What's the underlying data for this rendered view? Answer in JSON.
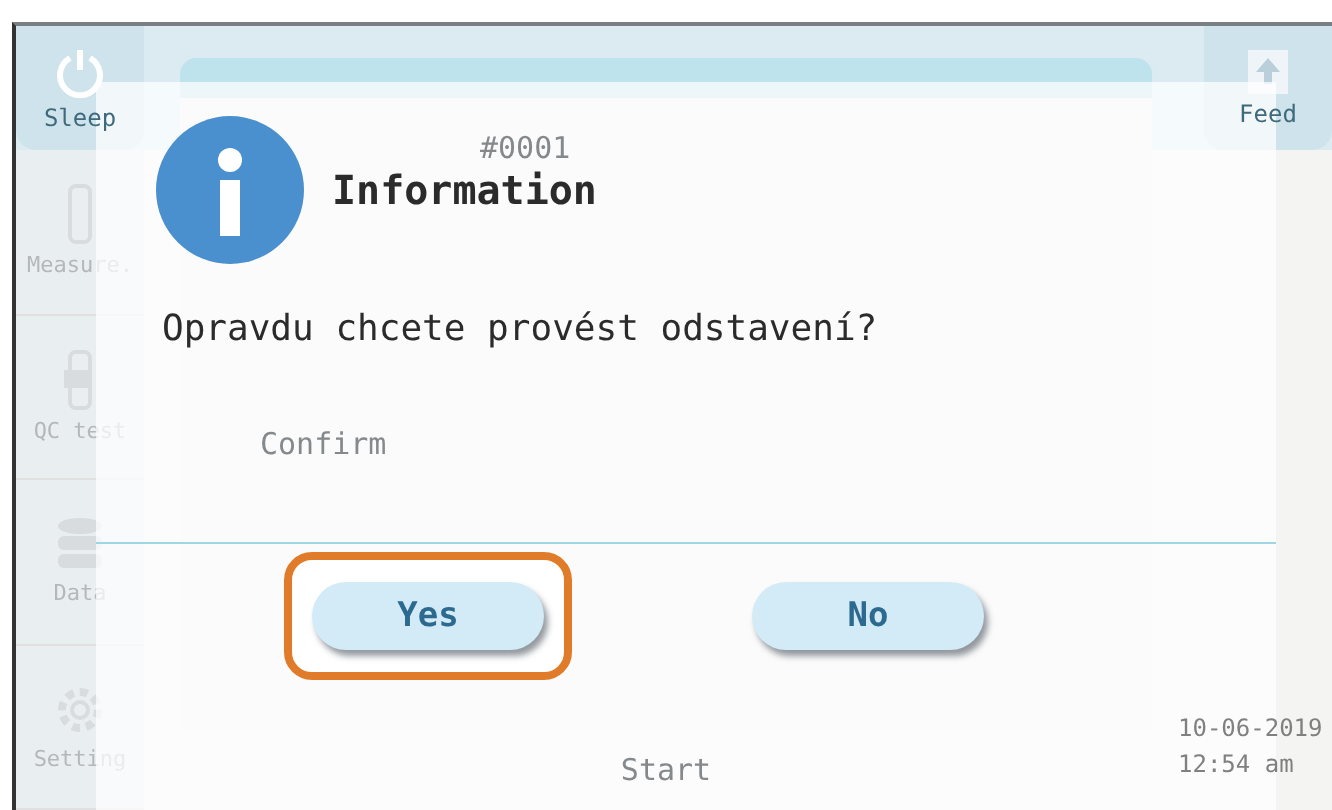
{
  "background": {
    "top_left": {
      "label": "Sleep"
    },
    "top_right": {
      "label": "Feed"
    },
    "sidebar": [
      {
        "label": "Measure."
      },
      {
        "label": "QC test"
      },
      {
        "label": "Data"
      },
      {
        "label": "Setting"
      }
    ],
    "sample_id": "#0001",
    "confirm": "Confirm",
    "start": "Start",
    "date": "10-06-2019",
    "time": "12:54 am"
  },
  "dialog": {
    "title": "Information",
    "message": "Opravdu chcete provést odstavení?",
    "buttons": [
      {
        "label": "Yes",
        "highlighted": true
      },
      {
        "label": "No",
        "highlighted": false
      }
    ]
  }
}
